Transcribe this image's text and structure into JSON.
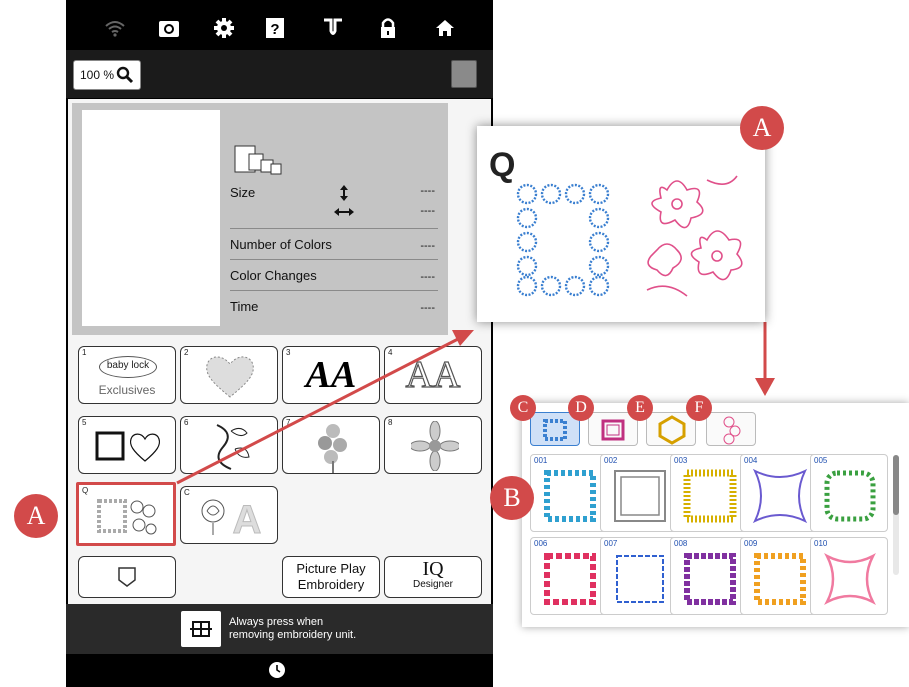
{
  "topbar": {
    "icons": [
      "wifi-icon",
      "camera-icon",
      "gear-icon",
      "help-icon",
      "needle-icon",
      "lock-icon",
      "home-icon"
    ]
  },
  "zoom": {
    "label": "100 %"
  },
  "info": {
    "size_label": "Size",
    "size_w": "----",
    "size_h": "----",
    "colors_label": "Number of Colors",
    "colors_val": "----",
    "changes_label": "Color Changes",
    "changes_val": "----",
    "time_label": "Time",
    "time_val": "----"
  },
  "categories": [
    {
      "num": "1",
      "line1": "baby lock",
      "line2": "Exclusives"
    },
    {
      "num": "2"
    },
    {
      "num": "3",
      "text": "AA"
    },
    {
      "num": "4",
      "text": "AA"
    },
    {
      "num": "5"
    },
    {
      "num": "6"
    },
    {
      "num": "7"
    },
    {
      "num": "8"
    },
    {
      "num": "Q"
    },
    {
      "num": "C"
    }
  ],
  "buttons": {
    "picture_play_1": "Picture Play",
    "picture_play_2": "Embroidery",
    "iq_1": "IQ",
    "iq_2": "Designer"
  },
  "notice": {
    "line1": "Always press when",
    "line2": "removing embroidery unit."
  },
  "callouts": {
    "a1": "A",
    "a2": "A",
    "b": "B",
    "c": "C",
    "d": "D",
    "e": "E",
    "f": "F"
  },
  "zoom_box": {
    "letter": "Q"
  },
  "frames": [
    "001",
    "002",
    "003",
    "004",
    "005",
    "006",
    "007",
    "008",
    "009",
    "010"
  ],
  "colors": {
    "accent": "#d24a4a",
    "blue": "#3a7fd0",
    "pink": "#e0508a"
  }
}
